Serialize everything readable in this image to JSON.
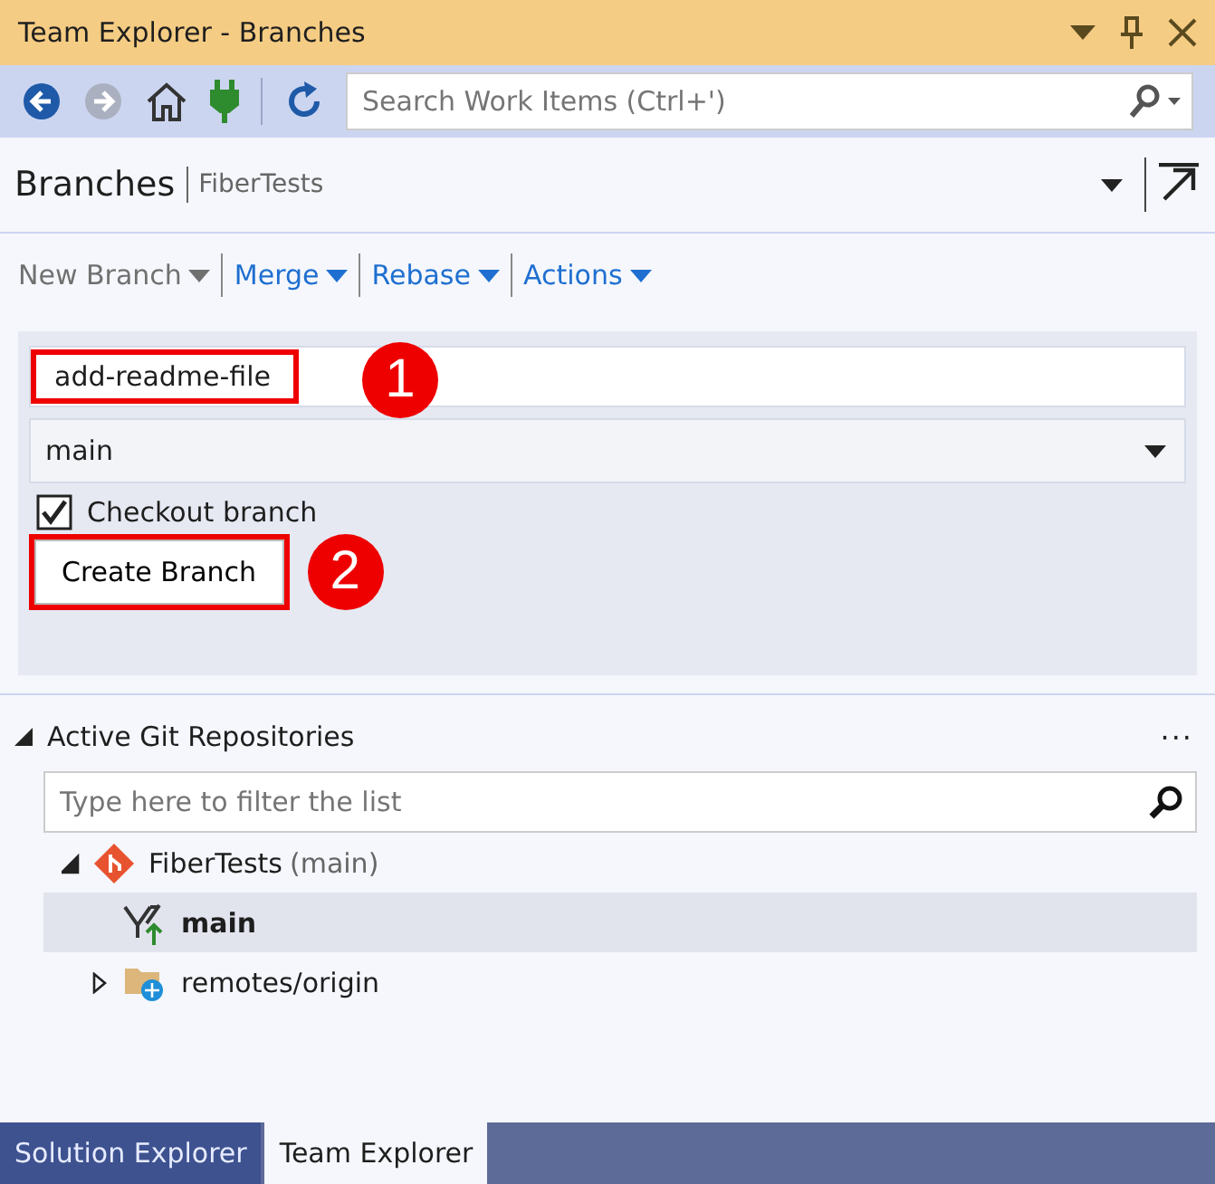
{
  "window": {
    "title": "Team Explorer - Branches"
  },
  "toolbar": {
    "search": {
      "placeholder": "Search Work Items (Ctrl+')"
    }
  },
  "header": {
    "title": "Branches",
    "subtitle": "FiberTests"
  },
  "actions": [
    {
      "label": "New Branch",
      "disabled": true
    },
    {
      "label": "Merge",
      "disabled": false
    },
    {
      "label": "Rebase",
      "disabled": false
    },
    {
      "label": "Actions",
      "disabled": false
    }
  ],
  "form": {
    "name_field": {
      "value": "add-readme-file",
      "highlighted": true,
      "callout": "1"
    },
    "base_branch": {
      "value": "main"
    },
    "checkout": {
      "label": "Checkout branch",
      "checked": true
    },
    "create_button": {
      "label": "Create Branch",
      "highlighted": true,
      "callout": "2"
    }
  },
  "repositories": {
    "title": "Active Git Repositories",
    "expanded": true,
    "more": "···",
    "filter": {
      "placeholder": "Type here to filter the list"
    },
    "tree": [
      {
        "kind": "repo",
        "label": "FiberTests",
        "note": "(main)",
        "expanded": true,
        "selected": false,
        "children": [
          {
            "kind": "branch",
            "label": "main",
            "selected": true
          },
          {
            "kind": "remote",
            "label": "remotes/origin",
            "expanded": false,
            "selected": false
          }
        ]
      }
    ]
  },
  "bottom_tabs": [
    {
      "label": "Solution Explorer",
      "selected": false
    },
    {
      "label": "Team Explorer",
      "selected": true
    }
  ]
}
